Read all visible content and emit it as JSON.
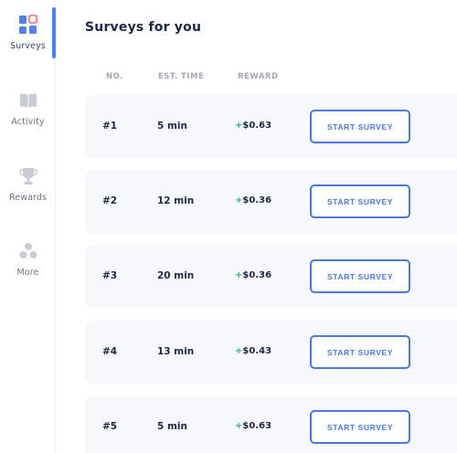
{
  "sidebar": {
    "items": [
      {
        "label": "Surveys",
        "icon": "surveys-icon",
        "active": true
      },
      {
        "label": "Activity",
        "icon": "book-icon",
        "active": false
      },
      {
        "label": "Rewards",
        "icon": "trophy-icon",
        "active": false
      },
      {
        "label": "More",
        "icon": "more-dots-icon",
        "active": false
      }
    ]
  },
  "main": {
    "title": "Surveys for you",
    "columns": {
      "no": "NO.",
      "time": "EST. TIME",
      "reward": "REWARD"
    },
    "rows": [
      {
        "no": "#1",
        "time": "5 min",
        "reward_sign": "+",
        "reward": "$0.63",
        "button": "START SURVEY"
      },
      {
        "no": "#2",
        "time": "12 min",
        "reward_sign": "+",
        "reward": "$0.36",
        "button": "START SURVEY"
      },
      {
        "no": "#3",
        "time": "20 min",
        "reward_sign": "+",
        "reward": "$0.36",
        "button": "START SURVEY"
      },
      {
        "no": "#4",
        "time": "13 min",
        "reward_sign": "+",
        "reward": "$0.43",
        "button": "START SURVEY"
      },
      {
        "no": "#5",
        "time": "5 min",
        "reward_sign": "+",
        "reward": "$0.63",
        "button": "START SURVEY"
      }
    ]
  },
  "colors": {
    "accent": "#4a78e0",
    "reward_plus": "#29b36e",
    "row_bg": "#f7f8fc",
    "active_indicator": "#4f7ff0"
  }
}
